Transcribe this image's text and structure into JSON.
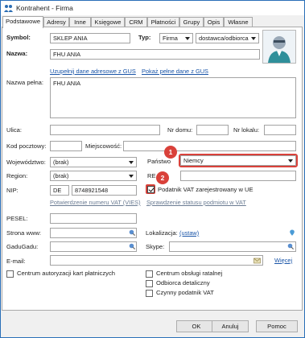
{
  "window": {
    "title": "Kontrahent - Firma"
  },
  "tabs": [
    {
      "label": "Podstawowe"
    },
    {
      "label": "Adresy"
    },
    {
      "label": "Inne"
    },
    {
      "label": "Księgowe"
    },
    {
      "label": "CRM"
    },
    {
      "label": "Płatności"
    },
    {
      "label": "Grupy"
    },
    {
      "label": "Opis"
    },
    {
      "label": "Własne"
    }
  ],
  "form": {
    "symbol_label": "Symbol:",
    "symbol_value": "SKLEP ANIA",
    "typ_label": "Typ:",
    "typ_value": "Firma",
    "role_value": "dostawca/odbiorca",
    "nazwa_label": "Nazwa:",
    "nazwa_value": "FHU ANIA",
    "gus_link_1": "Uzupełnij dane adresowe z GUS",
    "gus_link_2": "Pokaż pełne dane z GUS",
    "nazwa_pelna_label": "Nazwa pełna:",
    "nazwa_pelna_value": "FHU ANIA",
    "ulica_label": "Ulica:",
    "nr_domu_label": "Nr domu:",
    "nr_lokalu_label": "Nr lokalu:",
    "kod_label": "Kod pocztowy:",
    "miejscowosc_label": "Miejscowość:",
    "wojewodztwo_label": "Województwo:",
    "wojewodztwo_value": "(brak)",
    "panstwo_label": "Państwo",
    "panstwo_value": "Niemcy",
    "region_label": "Region:",
    "region_value": "(brak)",
    "regon_label": "RE",
    "nip_label": "NIP:",
    "nip_prefix": "DE",
    "nip_value": "8748921548",
    "vat_ue_label": "Podatnik VAT zarejestrowany w UE",
    "vies_link": "Potwierdzenie numeru VAT (VIES)",
    "status_vat_link": "Sprawdzenie statusu podmiotu w VAT",
    "pesel_label": "PESEL:",
    "www_label": "Strona www:",
    "lokalizacja_label": "Lokalizacja:",
    "lokalizacja_link": "(ustaw)",
    "gadugadu_label": "GaduGadu:",
    "skype_label": "Skype:",
    "email_label": "E-mail:",
    "wiecej_link": "Więcej",
    "check_centrum_kart": "Centrum autoryzacji kart płatniczych",
    "check_centrum_ratalne": "Centrum obsługi ratalnej",
    "check_odbiorca": "Odbiorca detaliczny",
    "check_czynny_vat": "Czynny podatnik VAT",
    "check_vat_ue_checked": true
  },
  "annotations": {
    "badge_1": "1",
    "badge_2": "2"
  },
  "buttons": {
    "ok": "OK",
    "anuluj": "Anuluj",
    "pomoc": "Pomoc"
  },
  "colors": {
    "accent_red": "#d9413a",
    "link_blue": "#1a55a8",
    "window_border": "#2a6fb8"
  },
  "icons": [
    "app-icon",
    "avatar-icon",
    "dropdown-arrow-icon",
    "globe-search-icon",
    "location-pin-icon",
    "email-icon"
  ]
}
